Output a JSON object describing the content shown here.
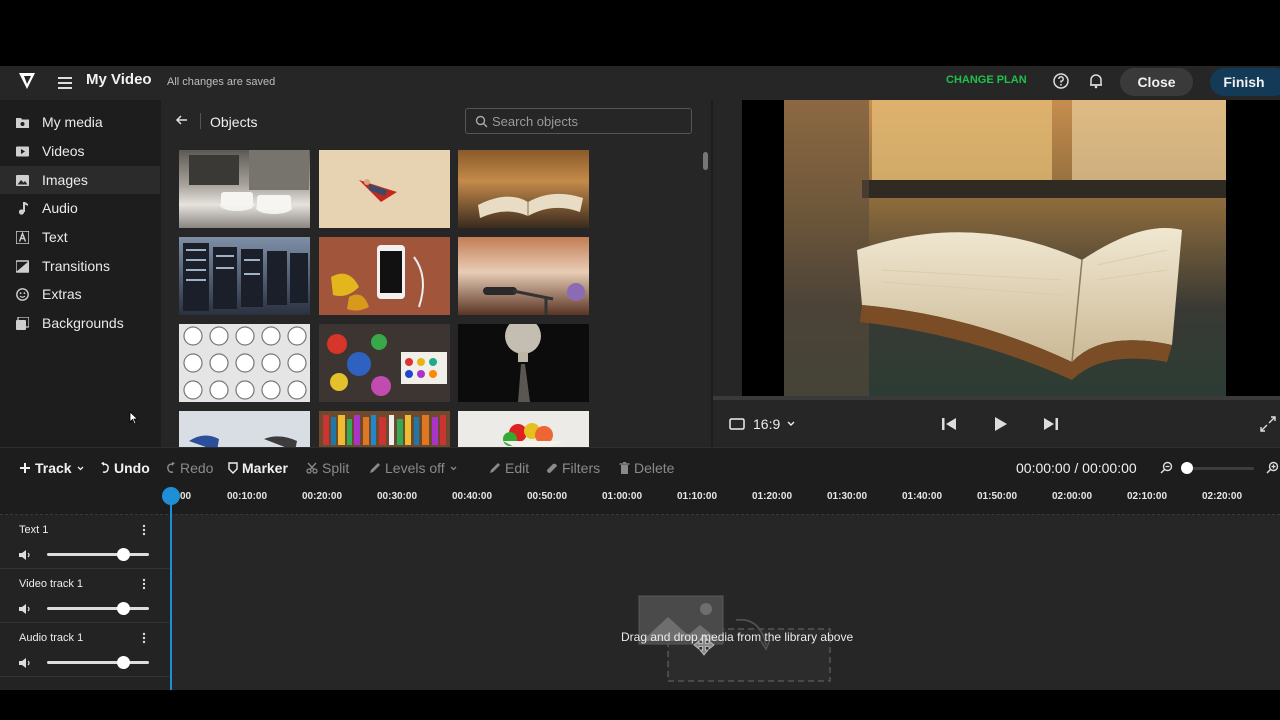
{
  "header": {
    "title": "My Video",
    "save_status": "All changes are saved",
    "change_plan": "CHANGE PLAN",
    "close": "Close",
    "finish": "Finish",
    "icons": [
      "logo-icon",
      "menu-icon",
      "help-icon",
      "bell-icon"
    ]
  },
  "sidebar": {
    "items": [
      {
        "label": "My media",
        "icon": "folder-icon"
      },
      {
        "label": "Videos",
        "icon": "video-icon"
      },
      {
        "label": "Images",
        "icon": "image-icon",
        "active": true
      },
      {
        "label": "Audio",
        "icon": "music-note-icon"
      },
      {
        "label": "Text",
        "icon": "text-icon"
      },
      {
        "label": "Transitions",
        "icon": "transition-icon"
      },
      {
        "label": "Extras",
        "icon": "smiley-icon"
      },
      {
        "label": "Backgrounds",
        "icon": "backgrounds-icon"
      }
    ]
  },
  "library": {
    "title": "Objects",
    "search_placeholder": "Search objects",
    "thumbnails": [
      "coffee-machine-image",
      "flying-superhero-image",
      "open-book-image",
      "server-racks-image",
      "phone-on-wood-image",
      "microphone-image",
      "clocks-grid-image",
      "paint-palette-image",
      "light-bulb-image",
      "shoes-image",
      "bookshelf-image",
      "fruit-bowl-image"
    ]
  },
  "preview": {
    "aspect_ratio": "16:9"
  },
  "toolbar": {
    "track": "Track",
    "undo": "Undo",
    "redo": "Redo",
    "marker": "Marker",
    "split": "Split",
    "levels": "Levels off",
    "edit": "Edit",
    "filters": "Filters",
    "delete": "Delete",
    "timecode": "00:00:00 / 00:00:00"
  },
  "timeline": {
    "ticks": [
      "00",
      "00:10:00",
      "00:20:00",
      "00:30:00",
      "00:40:00",
      "00:50:00",
      "01:00:00",
      "01:10:00",
      "01:20:00",
      "01:30:00",
      "01:40:00",
      "01:50:00",
      "02:00:00",
      "02:10:00",
      "02:20:00"
    ],
    "tracks": [
      {
        "name": "Text 1"
      },
      {
        "name": "Video track 1"
      },
      {
        "name": "Audio track 1"
      }
    ],
    "drop_hint": "Drag and drop media from the library above"
  },
  "colors": {
    "accent": "#1e8fd6",
    "change_plan": "#1ec24b",
    "finish_bg": "#133a57"
  }
}
